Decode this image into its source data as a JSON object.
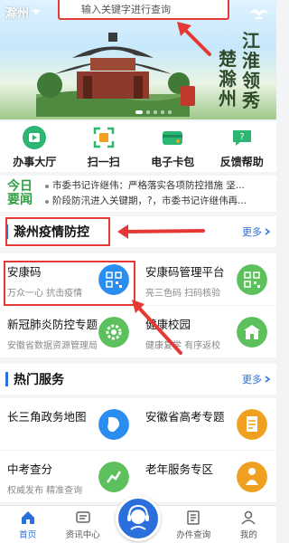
{
  "header": {
    "city": "滁州",
    "search_placeholder": "输入关键字进行查询"
  },
  "banner": {
    "calligraphy_line1": "江淮领秀",
    "calligraphy_line2": "楚滁州",
    "slide_count": 5,
    "active_slide": 1
  },
  "quick_actions": [
    {
      "label": "办事大厅",
      "icon": "hall-icon",
      "color": "#2bb673"
    },
    {
      "label": "扫一扫",
      "icon": "scan-icon",
      "color": "#2bb673"
    },
    {
      "label": "电子卡包",
      "icon": "card-wallet-icon",
      "color": "#2bb673"
    },
    {
      "label": "反馈帮助",
      "icon": "help-icon",
      "color": "#2bb673"
    }
  ],
  "news": {
    "badge_line1": "今日",
    "badge_line2": "要闻",
    "items": [
      "市委书记许继伟：严格落实各项防控措施 坚...",
      "阶段防汛进入关键期，?，市委书记许继伟再..."
    ]
  },
  "epidemic_section": {
    "title": "滁州疫情防控",
    "more_label": "更多",
    "cards": [
      {
        "title": "安康码",
        "subtitle": "万众一心 抗击疫情",
        "icon": "qr-code-icon",
        "color": "#2a8df0"
      },
      {
        "title": "安康码管理平台",
        "subtitle": "亮三色码 扫码核验",
        "icon": "qr-code-icon",
        "color": "#5cc05c"
      },
      {
        "title": "新冠肺炎防控专题",
        "subtitle": "安徽省数据资源管理局",
        "icon": "gear-icon",
        "color": "#5cc05c"
      },
      {
        "title": "健康校园",
        "subtitle": "健康复学 有序返校",
        "icon": "school-icon",
        "color": "#5cc05c"
      }
    ]
  },
  "hot_services": {
    "title": "热门服务",
    "more_label": "更多",
    "cards": [
      {
        "title": "长三角政务地图",
        "subtitle": "",
        "icon": "map-icon",
        "color": "#2a8df0"
      },
      {
        "title": "安徽省高考专题",
        "subtitle": "",
        "icon": "exam-icon",
        "color": "#f0a020"
      },
      {
        "title": "中考查分",
        "subtitle": "权威发布 精准查询",
        "icon": "score-icon",
        "color": "#5cc05c"
      },
      {
        "title": "老年服务专区",
        "subtitle": "",
        "icon": "elderly-icon",
        "color": "#f0a020"
      }
    ]
  },
  "bottom_nav": [
    {
      "label": "首页",
      "icon": "home-icon",
      "active": true
    },
    {
      "label": "资讯中心",
      "icon": "news-icon",
      "active": false
    },
    {
      "label": "",
      "icon": "customer-service-icon",
      "active": false
    },
    {
      "label": "办件查询",
      "icon": "query-icon",
      "active": false
    },
    {
      "label": "我的",
      "icon": "user-icon",
      "active": false
    }
  ],
  "colors": {
    "primary": "#2a6fdb",
    "green": "#2bb673",
    "highlight": "#e53935"
  }
}
